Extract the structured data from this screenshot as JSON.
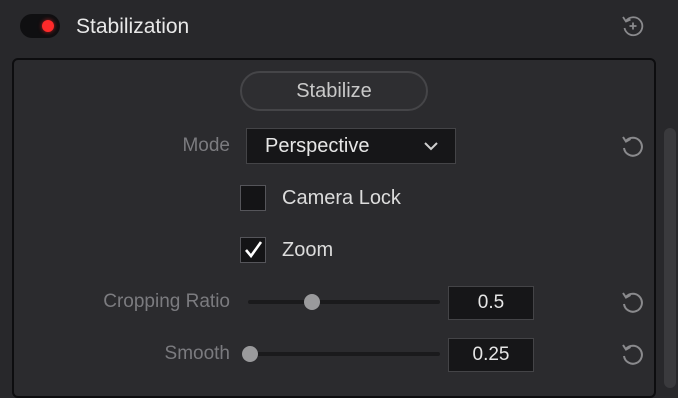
{
  "header": {
    "title": "Stabilization",
    "toggle_on": true,
    "toggle_color": "#ff2a2a",
    "reset_icon": "reset-plus-icon"
  },
  "panel": {
    "stabilize_button": "Stabilize",
    "mode": {
      "label": "Mode",
      "value": "Perspective",
      "reset_icon": "reset-icon"
    },
    "camera_lock": {
      "label": "Camera Lock",
      "checked": false
    },
    "zoom": {
      "label": "Zoom",
      "checked": true
    },
    "cropping_ratio": {
      "label": "Cropping Ratio",
      "value": "0.5",
      "slider_fraction": 0.33,
      "reset_icon": "reset-icon"
    },
    "smooth": {
      "label": "Smooth",
      "value": "0.25",
      "slider_fraction": 0.0,
      "reset_icon": "reset-icon"
    }
  }
}
